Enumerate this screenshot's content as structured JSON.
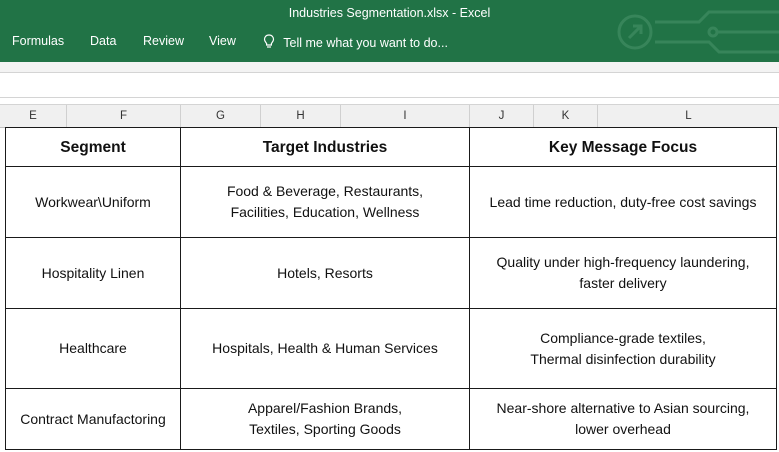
{
  "window": {
    "title": "Industries Segmentation.xlsx - Excel"
  },
  "menu": {
    "items": [
      "Formulas",
      "Data",
      "Review",
      "View"
    ],
    "tell_me": "Tell me what you want to do..."
  },
  "columns": [
    "E",
    "F",
    "G",
    "H",
    "I",
    "J",
    "K",
    "L"
  ],
  "table": {
    "headers": [
      "Segment",
      "Target Industries",
      "Key Message Focus"
    ],
    "rows": [
      [
        "Workwear\\Uniform",
        "Food & Beverage, Restaurants,\nFacilities, Education, Wellness",
        "Lead time reduction, duty-free cost savings"
      ],
      [
        "Hospitality Linen",
        "Hotels, Resorts",
        "Quality under high-frequency laundering,\nfaster delivery"
      ],
      [
        "Healthcare",
        "Hospitals, Health & Human Services",
        "Compliance-grade textiles,\nThermal disinfection durability"
      ],
      [
        "Contract Manufactoring",
        "Apparel/Fashion Brands,\nTextiles, Sporting Goods",
        "Near-shore alternative to Asian sourcing,\nlower overhead"
      ]
    ]
  },
  "colors": {
    "ribbon": "#217346"
  }
}
